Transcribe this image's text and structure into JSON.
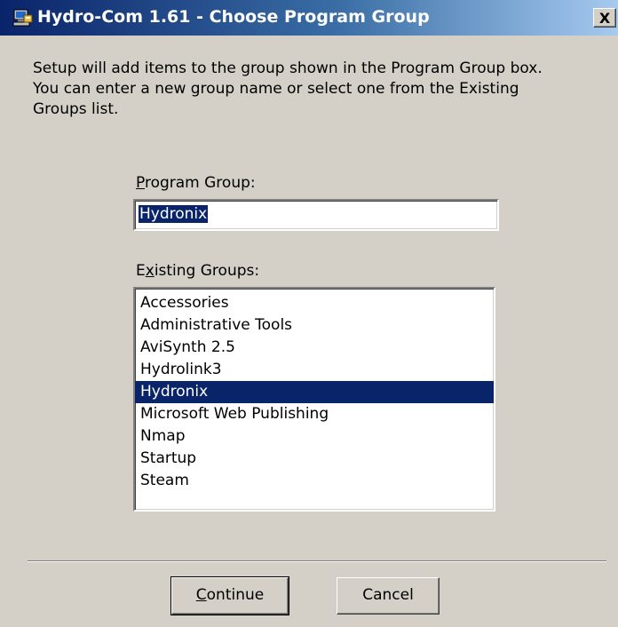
{
  "window": {
    "title": "Hydro-Com 1.61 - Choose Program Group",
    "close_label": "X"
  },
  "intro": {
    "line1": "Setup will add items to the group shown in the Program Group box.",
    "line2": "You can enter a new group name or select one from the Existing",
    "line3": "Groups list."
  },
  "program_group": {
    "label_mnemonic": "P",
    "label_rest": "rogram Group:",
    "value": "Hydronix"
  },
  "existing_groups": {
    "label_pre": "E",
    "label_mnemonic": "x",
    "label_rest": "isting Groups:",
    "items": [
      "Accessories",
      "Administrative Tools",
      "AviSynth 2.5",
      "Hydrolink3",
      "Hydronix",
      "Microsoft Web Publishing",
      "Nmap",
      "Startup",
      "Steam"
    ],
    "selected": "Hydronix"
  },
  "buttons": {
    "continue_mnemonic": "C",
    "continue_rest": "ontinue",
    "cancel": "Cancel"
  },
  "colors": {
    "selection": "#0a246a",
    "face": "#d4d0c8"
  },
  "icons": {
    "title": "setup-computer-icon"
  }
}
